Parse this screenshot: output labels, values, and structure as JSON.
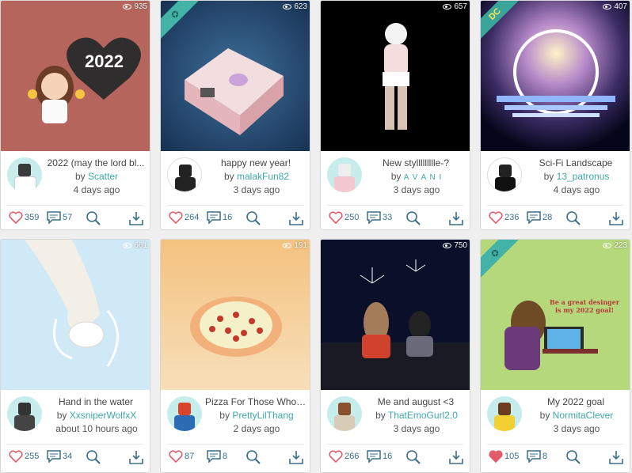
{
  "cards": [
    {
      "views": "935",
      "title": "2022 (may the lord bl...",
      "by": "by",
      "author": "Scatter",
      "time": "4 days ago",
      "likes": "359",
      "comments": "57",
      "badge": "",
      "thumb_text": "2022",
      "liked": false
    },
    {
      "views": "623",
      "title": "happy new year!",
      "by": "by",
      "author": "malakFun82",
      "time": "3 days ago",
      "likes": "264",
      "comments": "16",
      "badge": "star",
      "liked": false
    },
    {
      "views": "657",
      "title": "New styllllllllle-?",
      "by": "by",
      "author": "A V A N I",
      "time": "3 days ago",
      "likes": "250",
      "comments": "33",
      "badge": "",
      "liked": false
    },
    {
      "views": "407",
      "title": "Sci-Fi Landscape",
      "by": "by",
      "author": "13_patronus",
      "time": "4 days ago",
      "likes": "236",
      "comments": "28",
      "badge": "DC",
      "liked": false
    },
    {
      "views": "661",
      "title": "Hand in the water",
      "by": "by",
      "author": "XxsniperWolfxX",
      "time": "about 10 hours ago",
      "likes": "255",
      "comments": "34",
      "badge": "",
      "liked": false
    },
    {
      "views": "191",
      "title": "Pizza For Those Who ...",
      "by": "by",
      "author": "PrettyLilThang",
      "time": "2 days ago",
      "likes": "87",
      "comments": "8",
      "badge": "",
      "liked": false
    },
    {
      "views": "750",
      "title": "Me and august <3",
      "by": "by",
      "author": "ThatEmoGurl2.0",
      "time": "3 days ago",
      "likes": "266",
      "comments": "16",
      "badge": "",
      "liked": false
    },
    {
      "views": "223",
      "title": "My 2022 goal",
      "by": "by",
      "author": "NormitaClever",
      "time": "3 days ago",
      "likes": "105",
      "comments": "8",
      "badge": "star",
      "thumb_text": "Be a great desinger is my 2022 goal!",
      "liked": true
    }
  ],
  "colors": {
    "accent": "#3fa9a9",
    "icon": "#3a6e8a",
    "like_fill": "#e35b6b"
  }
}
